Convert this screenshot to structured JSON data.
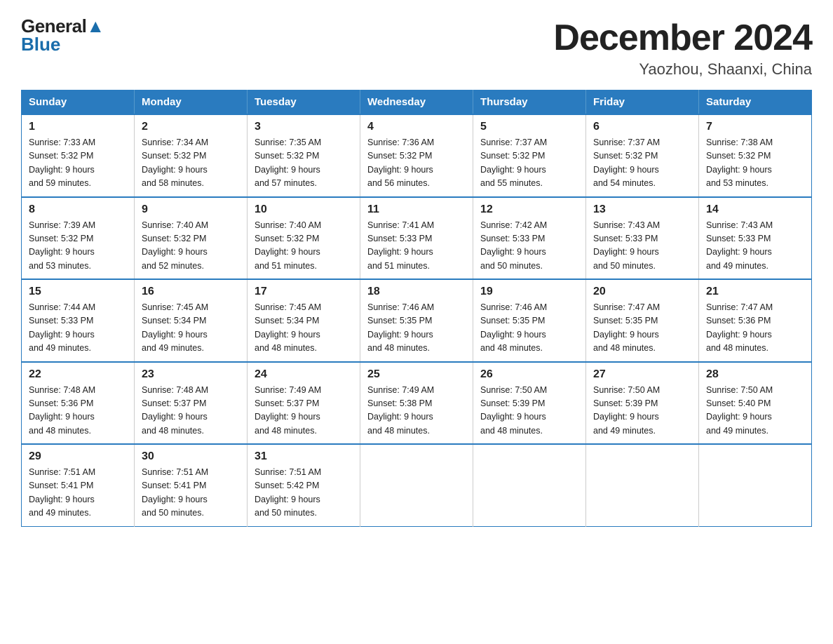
{
  "header": {
    "logo_general": "General",
    "logo_blue": "Blue",
    "month_title": "December 2024",
    "location": "Yaozhou, Shaanxi, China"
  },
  "columns": [
    "Sunday",
    "Monday",
    "Tuesday",
    "Wednesday",
    "Thursday",
    "Friday",
    "Saturday"
  ],
  "weeks": [
    [
      {
        "day": "1",
        "sunrise": "7:33 AM",
        "sunset": "5:32 PM",
        "daylight": "9 hours and 59 minutes."
      },
      {
        "day": "2",
        "sunrise": "7:34 AM",
        "sunset": "5:32 PM",
        "daylight": "9 hours and 58 minutes."
      },
      {
        "day": "3",
        "sunrise": "7:35 AM",
        "sunset": "5:32 PM",
        "daylight": "9 hours and 57 minutes."
      },
      {
        "day": "4",
        "sunrise": "7:36 AM",
        "sunset": "5:32 PM",
        "daylight": "9 hours and 56 minutes."
      },
      {
        "day": "5",
        "sunrise": "7:37 AM",
        "sunset": "5:32 PM",
        "daylight": "9 hours and 55 minutes."
      },
      {
        "day": "6",
        "sunrise": "7:37 AM",
        "sunset": "5:32 PM",
        "daylight": "9 hours and 54 minutes."
      },
      {
        "day": "7",
        "sunrise": "7:38 AM",
        "sunset": "5:32 PM",
        "daylight": "9 hours and 53 minutes."
      }
    ],
    [
      {
        "day": "8",
        "sunrise": "7:39 AM",
        "sunset": "5:32 PM",
        "daylight": "9 hours and 53 minutes."
      },
      {
        "day": "9",
        "sunrise": "7:40 AM",
        "sunset": "5:32 PM",
        "daylight": "9 hours and 52 minutes."
      },
      {
        "day": "10",
        "sunrise": "7:40 AM",
        "sunset": "5:32 PM",
        "daylight": "9 hours and 51 minutes."
      },
      {
        "day": "11",
        "sunrise": "7:41 AM",
        "sunset": "5:33 PM",
        "daylight": "9 hours and 51 minutes."
      },
      {
        "day": "12",
        "sunrise": "7:42 AM",
        "sunset": "5:33 PM",
        "daylight": "9 hours and 50 minutes."
      },
      {
        "day": "13",
        "sunrise": "7:43 AM",
        "sunset": "5:33 PM",
        "daylight": "9 hours and 50 minutes."
      },
      {
        "day": "14",
        "sunrise": "7:43 AM",
        "sunset": "5:33 PM",
        "daylight": "9 hours and 49 minutes."
      }
    ],
    [
      {
        "day": "15",
        "sunrise": "7:44 AM",
        "sunset": "5:33 PM",
        "daylight": "9 hours and 49 minutes."
      },
      {
        "day": "16",
        "sunrise": "7:45 AM",
        "sunset": "5:34 PM",
        "daylight": "9 hours and 49 minutes."
      },
      {
        "day": "17",
        "sunrise": "7:45 AM",
        "sunset": "5:34 PM",
        "daylight": "9 hours and 48 minutes."
      },
      {
        "day": "18",
        "sunrise": "7:46 AM",
        "sunset": "5:35 PM",
        "daylight": "9 hours and 48 minutes."
      },
      {
        "day": "19",
        "sunrise": "7:46 AM",
        "sunset": "5:35 PM",
        "daylight": "9 hours and 48 minutes."
      },
      {
        "day": "20",
        "sunrise": "7:47 AM",
        "sunset": "5:35 PM",
        "daylight": "9 hours and 48 minutes."
      },
      {
        "day": "21",
        "sunrise": "7:47 AM",
        "sunset": "5:36 PM",
        "daylight": "9 hours and 48 minutes."
      }
    ],
    [
      {
        "day": "22",
        "sunrise": "7:48 AM",
        "sunset": "5:36 PM",
        "daylight": "9 hours and 48 minutes."
      },
      {
        "day": "23",
        "sunrise": "7:48 AM",
        "sunset": "5:37 PM",
        "daylight": "9 hours and 48 minutes."
      },
      {
        "day": "24",
        "sunrise": "7:49 AM",
        "sunset": "5:37 PM",
        "daylight": "9 hours and 48 minutes."
      },
      {
        "day": "25",
        "sunrise": "7:49 AM",
        "sunset": "5:38 PM",
        "daylight": "9 hours and 48 minutes."
      },
      {
        "day": "26",
        "sunrise": "7:50 AM",
        "sunset": "5:39 PM",
        "daylight": "9 hours and 48 minutes."
      },
      {
        "day": "27",
        "sunrise": "7:50 AM",
        "sunset": "5:39 PM",
        "daylight": "9 hours and 49 minutes."
      },
      {
        "day": "28",
        "sunrise": "7:50 AM",
        "sunset": "5:40 PM",
        "daylight": "9 hours and 49 minutes."
      }
    ],
    [
      {
        "day": "29",
        "sunrise": "7:51 AM",
        "sunset": "5:41 PM",
        "daylight": "9 hours and 49 minutes."
      },
      {
        "day": "30",
        "sunrise": "7:51 AM",
        "sunset": "5:41 PM",
        "daylight": "9 hours and 50 minutes."
      },
      {
        "day": "31",
        "sunrise": "7:51 AM",
        "sunset": "5:42 PM",
        "daylight": "9 hours and 50 minutes."
      },
      null,
      null,
      null,
      null
    ]
  ],
  "labels": {
    "sunrise": "Sunrise:",
    "sunset": "Sunset:",
    "daylight": "Daylight: 9 hours"
  }
}
